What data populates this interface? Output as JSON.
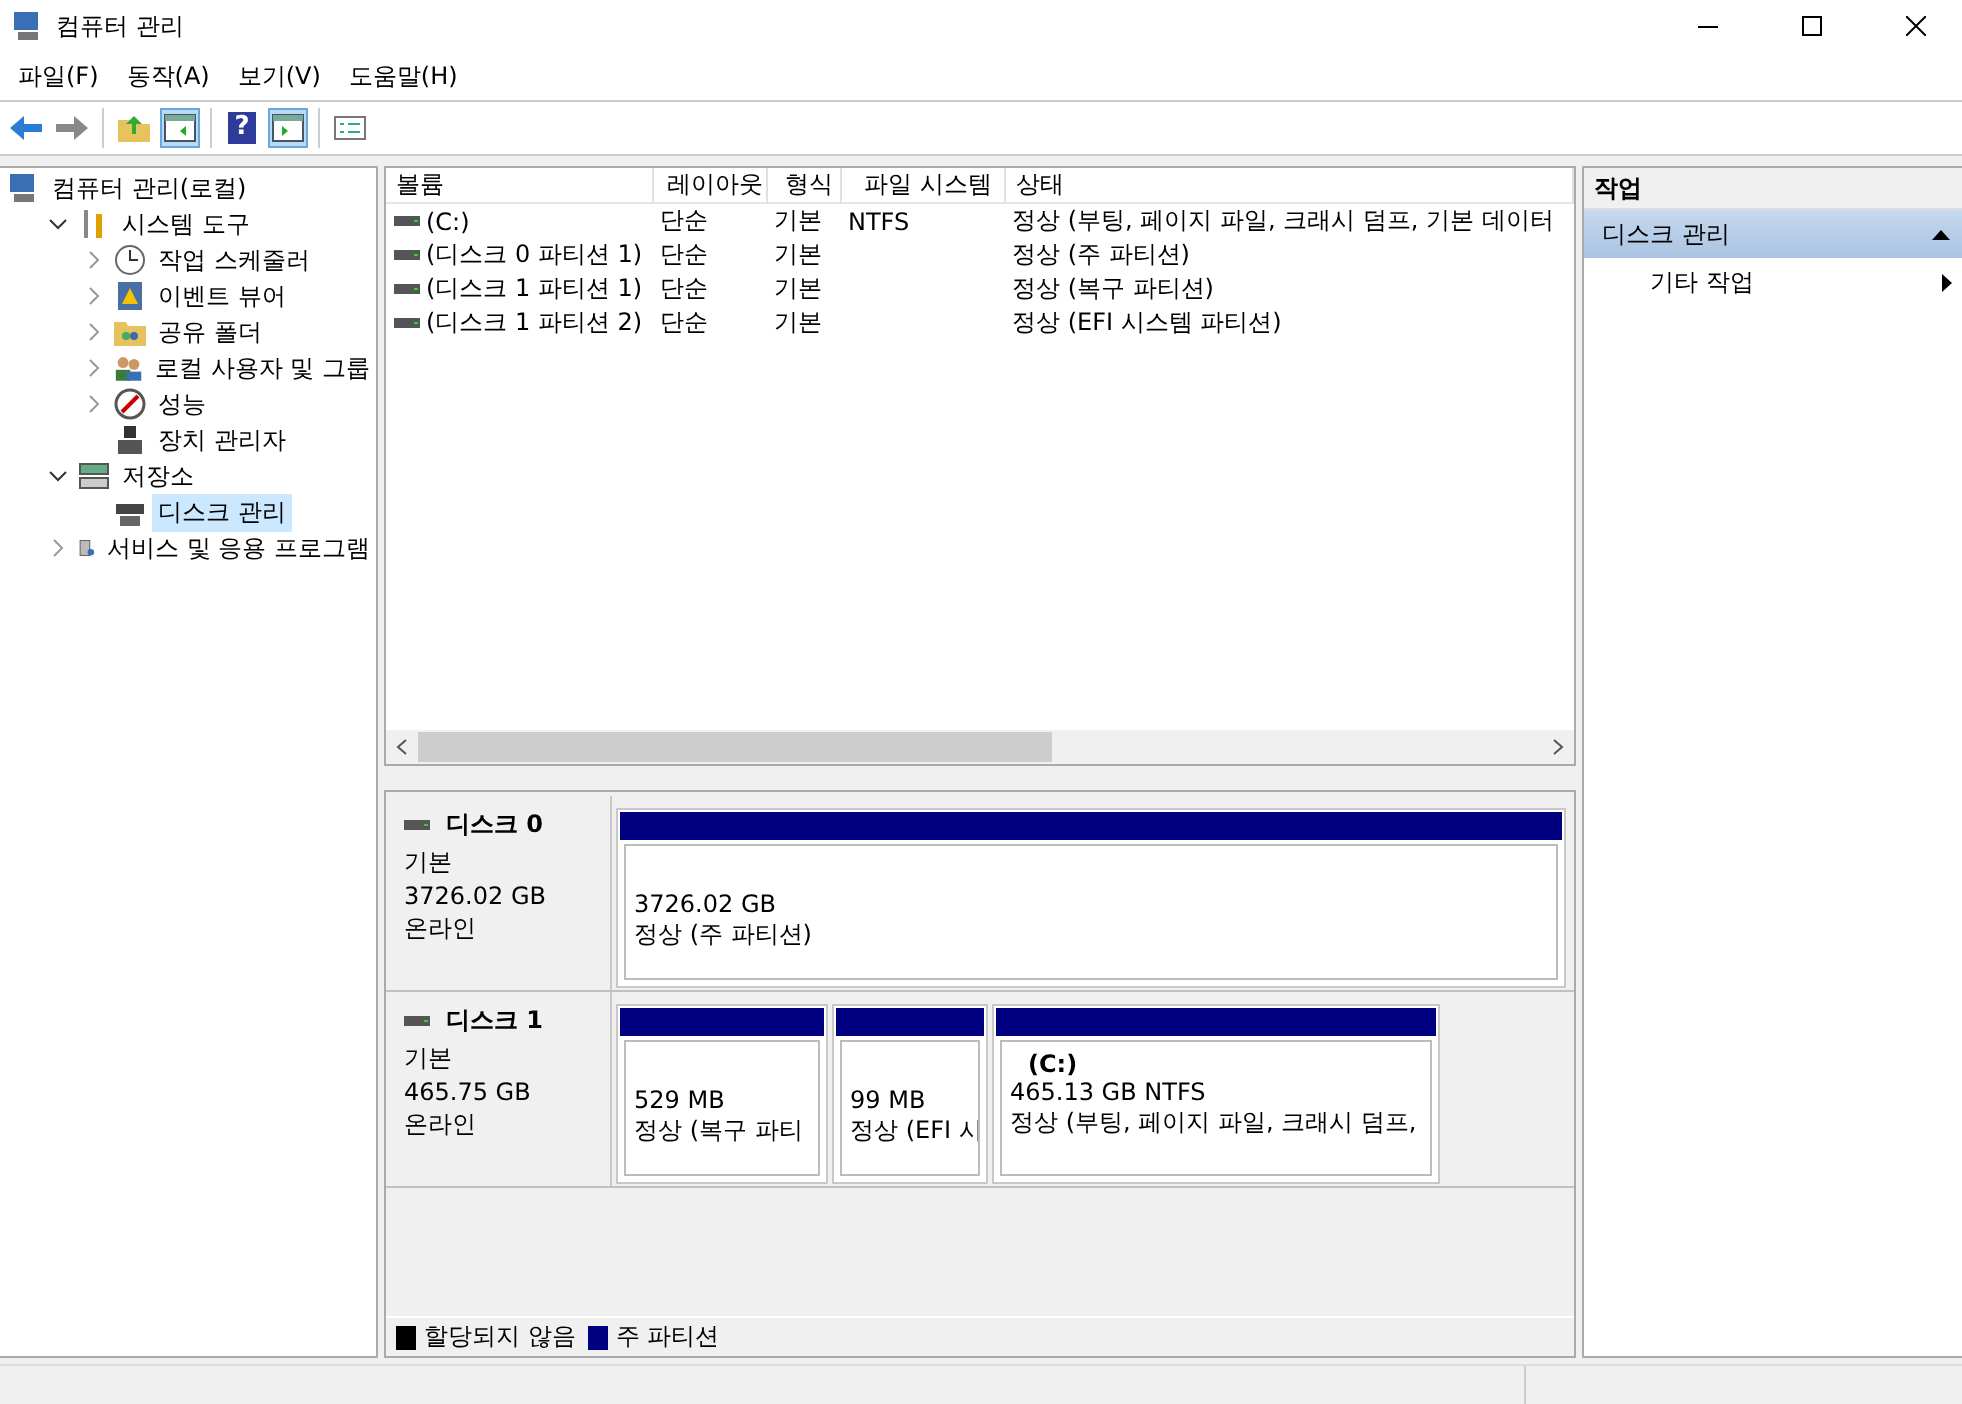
{
  "window": {
    "title": "컴퓨터 관리"
  },
  "menu": [
    "파일(F)",
    "동작(A)",
    "보기(V)",
    "도움말(H)"
  ],
  "toolbar": [
    {
      "kind": "back",
      "on": false
    },
    {
      "kind": "forward",
      "on": false
    },
    {
      "kind": "up",
      "on": false
    },
    {
      "kind": "tree",
      "on": true
    },
    {
      "kind": "help",
      "on": false,
      "text": "?"
    },
    {
      "kind": "pane",
      "on": true
    },
    {
      "kind": "props",
      "on": false
    }
  ],
  "tree": [
    {
      "label": "컴퓨터 관리(로컬)",
      "kind": "computer",
      "selected": false,
      "children": [
        {
          "label": "시스템 도구",
          "kind": "tools",
          "expanded": true,
          "selected": false,
          "children": [
            {
              "label": "작업 스케줄러",
              "kind": "clock",
              "expanded": false,
              "selected": false
            },
            {
              "label": "이벤트 뷰어",
              "kind": "event",
              "expanded": false,
              "selected": false
            },
            {
              "label": "공유 폴더",
              "kind": "folder",
              "expanded": false,
              "selected": false
            },
            {
              "label": "로컬 사용자 및 그룹",
              "kind": "users",
              "expanded": false,
              "selected": false
            },
            {
              "label": "성능",
              "kind": "perf",
              "expanded": false,
              "selected": false
            },
            {
              "label": "장치 관리자",
              "kind": "device",
              "selected": false
            }
          ]
        },
        {
          "label": "저장소",
          "kind": "storage",
          "expanded": true,
          "selected": false,
          "children": [
            {
              "label": "디스크 관리",
              "kind": "disk",
              "selected": true
            }
          ]
        },
        {
          "label": "서비스 및 응용 프로그램",
          "kind": "services",
          "expanded": false,
          "selected": false
        }
      ]
    }
  ],
  "volumes": {
    "columns": [
      "볼륨",
      "레이아웃",
      "형식",
      "파일 시스템",
      "상태"
    ],
    "rows": [
      {
        "cells": [
          "(C:)",
          "단순",
          "기본",
          "NTFS",
          "정상 (부팅, 페이지 파일, 크래시 덤프, 기본 데이터"
        ]
      },
      {
        "cells": [
          "(디스크 0 파티션 1)",
          "단순",
          "기본",
          "",
          "정상 (주 파티션)"
        ]
      },
      {
        "cells": [
          "(디스크 1 파티션 1)",
          "단순",
          "기본",
          "",
          "정상 (복구 파티션)"
        ]
      },
      {
        "cells": [
          "(디스크 1 파티션 2)",
          "단순",
          "기본",
          "",
          "정상 (EFI 시스템 파티션)"
        ]
      }
    ]
  },
  "disks": [
    {
      "name": "디스크 0",
      "type": "기본",
      "size": "3726.02 GB",
      "status": "온라인",
      "partitions": [
        {
          "size": "3726.02 GB",
          "status": "정상 (주 파티션)",
          "color": "#000080"
        }
      ]
    },
    {
      "name": "디스크 1",
      "type": "기본",
      "size": "465.75 GB",
      "status": "온라인",
      "partitions": [
        {
          "size": "529 MB",
          "status": "정상 (복구 파티",
          "color": "#000080"
        },
        {
          "size": "99 MB",
          "status": "정상 (EFI 시",
          "color": "#000080"
        },
        {
          "label": "(C:)",
          "size": "465.13 GB NTFS",
          "status": "정상 (부팅, 페이지 파일, 크래시 덤프,",
          "color": "#000080"
        }
      ]
    }
  ],
  "legend": [
    {
      "label": "할당되지 않음",
      "color": "#000000"
    },
    {
      "label": "주 파티션",
      "color": "#000080"
    }
  ],
  "actions": {
    "title": "작업",
    "sections": [
      {
        "label": "디스크 관리",
        "expanded": true,
        "items": [
          {
            "label": "기타 작업"
          }
        ]
      }
    ]
  }
}
